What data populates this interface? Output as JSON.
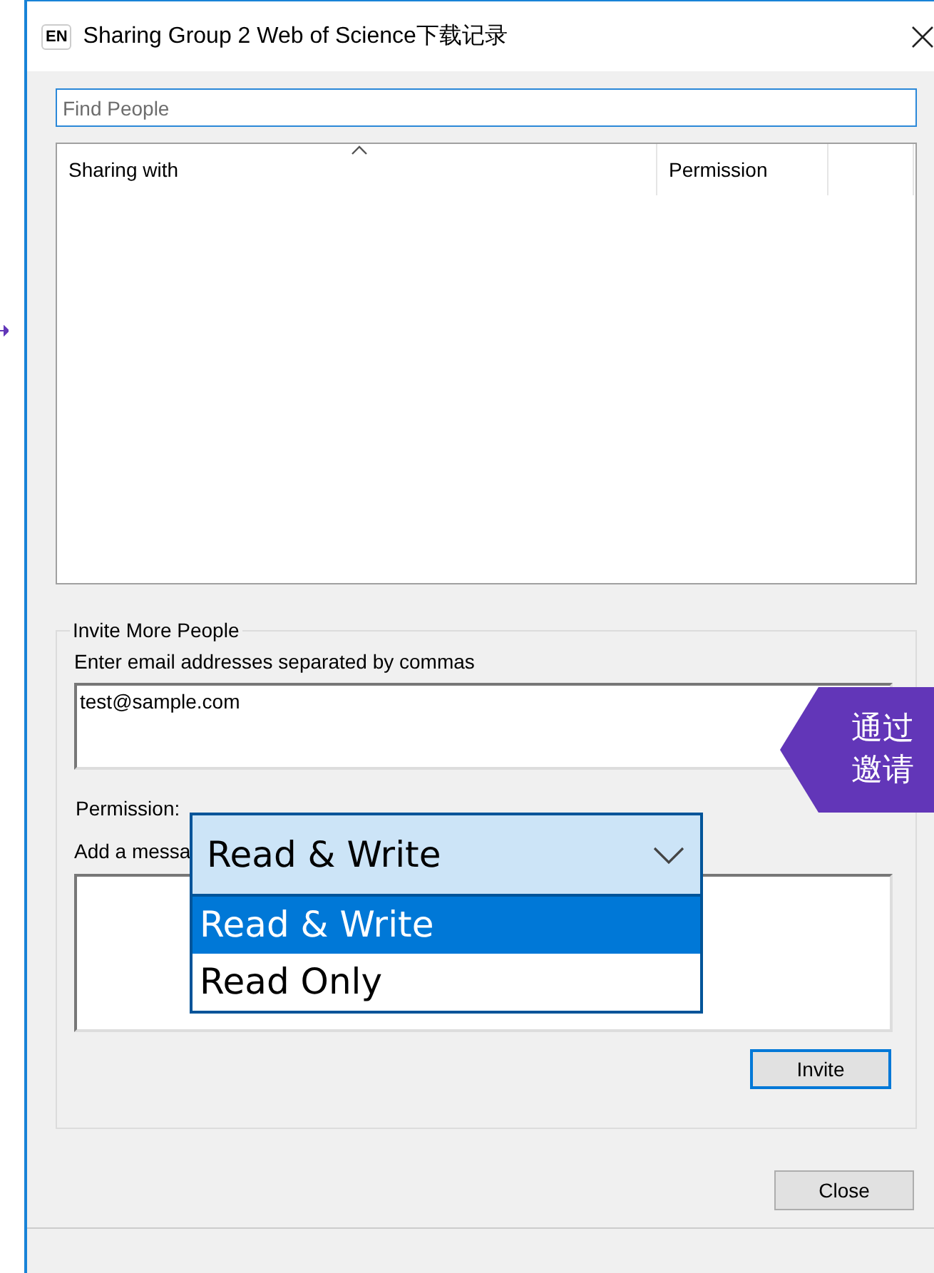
{
  "window": {
    "app_badge": "EN",
    "title": "Sharing Group 2 Web of Science下载记录"
  },
  "find_field": {
    "placeholder": "Find People"
  },
  "sharing_list": {
    "columns": [
      "Sharing with",
      "Permission"
    ]
  },
  "invite_group": {
    "title": "Invite More People",
    "email_label": "Enter email addresses separated by commas",
    "email_value": "test@sample.com",
    "permission_label": "Permission:",
    "message_label": "Add a messa",
    "invite_button": "Invite"
  },
  "permission_dropdown": {
    "value": "Read & Write",
    "expanded": true,
    "options": [
      {
        "label": "Read & Write",
        "selected": true
      },
      {
        "label": "Read Only",
        "selected": false
      }
    ]
  },
  "close_button": "Close",
  "callout": {
    "lines": [
      "通过",
      "邀请"
    ]
  }
}
